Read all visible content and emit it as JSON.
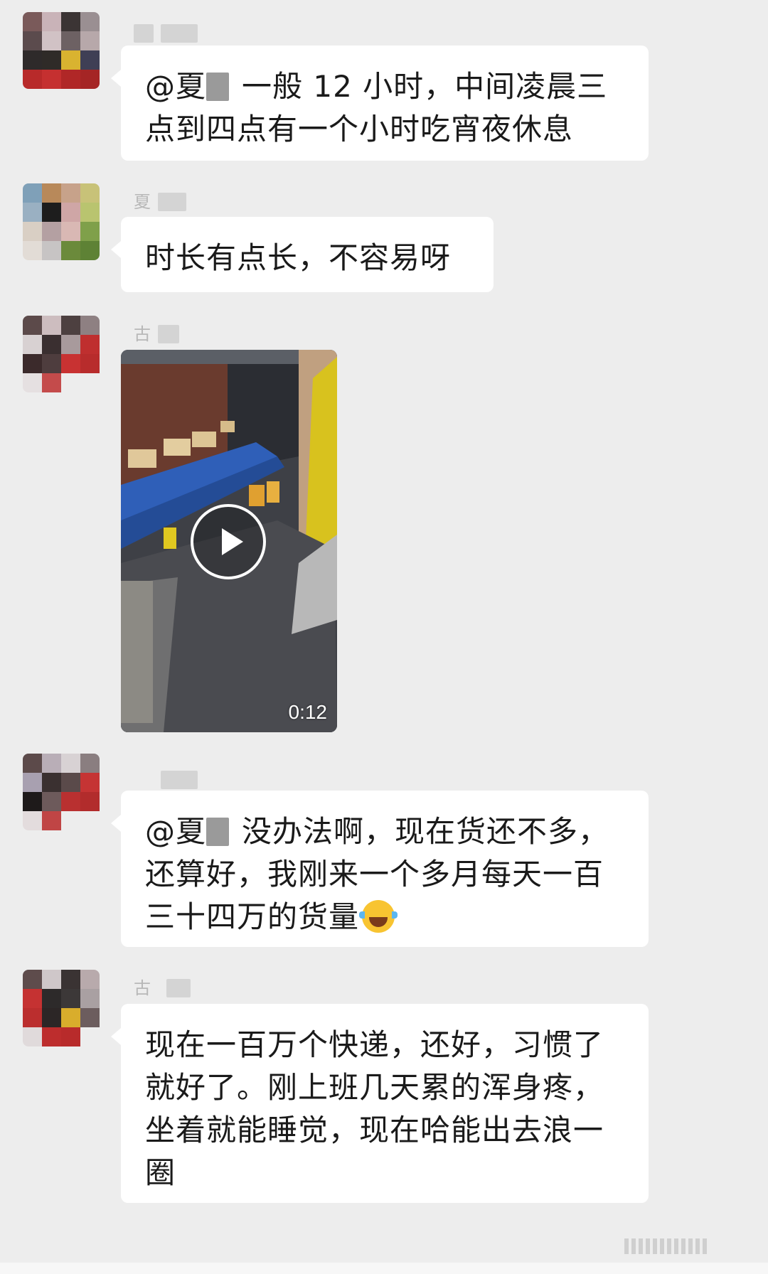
{
  "messages": [
    {
      "sender_fragment": "",
      "mention": "@夏",
      "text_line1": "一般 12 小时，中间凌晨三",
      "text_line2": "点到四点有一个小时吃宵夜休息"
    },
    {
      "sender_fragment": "夏",
      "text_line1": "时长有点长，不容易呀"
    },
    {
      "sender_fragment": "古",
      "video_duration": "0:12"
    },
    {
      "sender_fragment": "",
      "mention": "@夏",
      "text_line1": "没办法啊，现在货还不多，",
      "text_line2": "还算好，我刚来一个多月每天一百",
      "text_line3": "三十四万的货量",
      "emoji": "tears-of-joy-emoji"
    },
    {
      "sender_fragment": "古",
      "text_line1": "现在一百万个快递，还好，习惯了",
      "text_line2": "就好了。刚上班几天累的浑身疼，",
      "text_line3": "坐着就能睡觉，现在哈能出去浪一",
      "text_line4": "圈"
    }
  ],
  "colors": {
    "background": "#ededed",
    "bubble": "#ffffff",
    "text": "#1a1a1a"
  }
}
